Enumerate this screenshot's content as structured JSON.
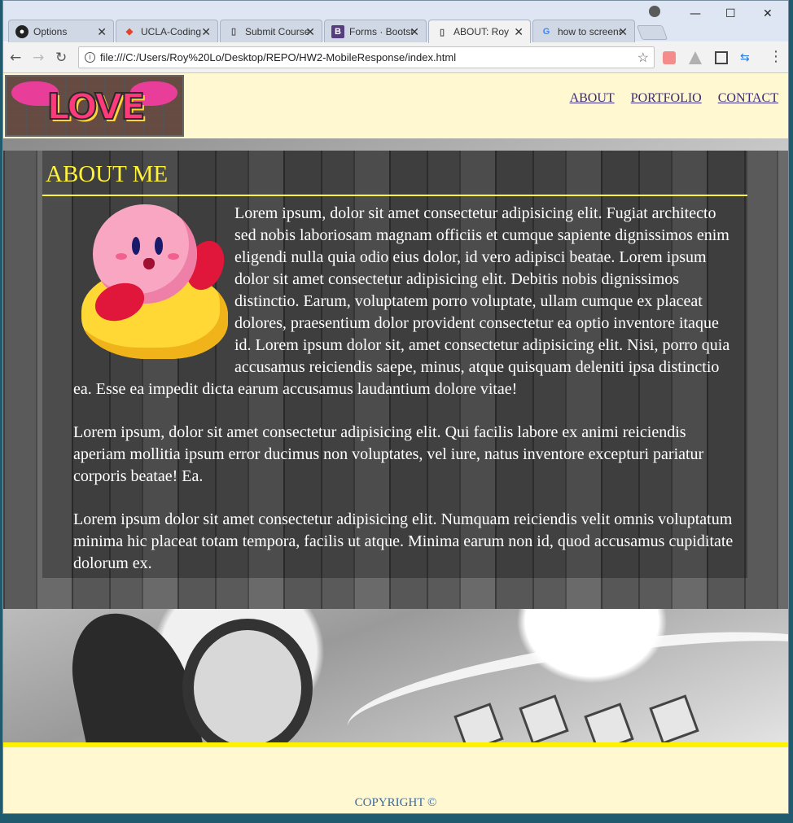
{
  "browser": {
    "tabs": [
      {
        "title": "Options",
        "icon": "github-icon"
      },
      {
        "title": "UCLA-Coding",
        "icon": "gitlab-icon"
      },
      {
        "title": "Submit Course",
        "icon": "document-icon"
      },
      {
        "title": "Forms · Bootstrap",
        "icon": "bootstrap-icon"
      },
      {
        "title": "ABOUT: Roy",
        "icon": "document-icon",
        "active": true
      },
      {
        "title": "how to screenshot",
        "icon": "google-icon"
      }
    ],
    "address": "file:///C:/Users/Roy%20Lo/Desktop/REPO/HW2-MobileResponse/index.html"
  },
  "site": {
    "logo_text": "LOVE",
    "nav": {
      "about": "ABOUT",
      "portfolio": "PORTFOLIO",
      "contact": "CONTACT"
    },
    "about": {
      "title": "ABOUT ME",
      "paragraphs": [
        "Lorem ipsum, dolor sit amet consectetur adipisicing elit. Fugiat architecto sed nobis laboriosam magnam officiis et cumque sapiente dignissimos enim eligendi nulla quia odio eius dolor, id vero adipisci beatae. Lorem ipsum dolor sit amet consectetur adipisicing elit. Debitis nobis dignissimos distinctio. Earum, voluptatem porro voluptate, ullam cumque ex placeat dolores, praesentium dolor provident consectetur ea optio inventore itaque id. Lorem ipsum dolor sit, amet consectetur adipisicing elit. Nisi, porro quia accusamus reiciendis saepe, minus, atque quisquam deleniti ipsa distinctio ea. Esse ea impedit dicta earum accusamus laudantium dolore vitae!",
        "Lorem ipsum, dolor sit amet consectetur adipisicing elit. Qui facilis labore ex animi reiciendis aperiam mollitia ipsum error ducimus non voluptates, vel iure, natus inventore excepturi pariatur corporis beatae! Ea.",
        "Lorem ipsum dolor sit amet consectetur adipisicing elit. Numquam reiciendis velit omnis voluptatum minima hic placeat totam tempora, facilis ut atque. Minima earum non id, quod accusamus cupiditate dolorum ex."
      ]
    },
    "footer": {
      "copyright": "COPYRIGHT ©"
    }
  },
  "colors": {
    "page_bg": "#fff8d1",
    "accent_yellow": "#fff23a",
    "nav_link": "#3a2a7a"
  }
}
